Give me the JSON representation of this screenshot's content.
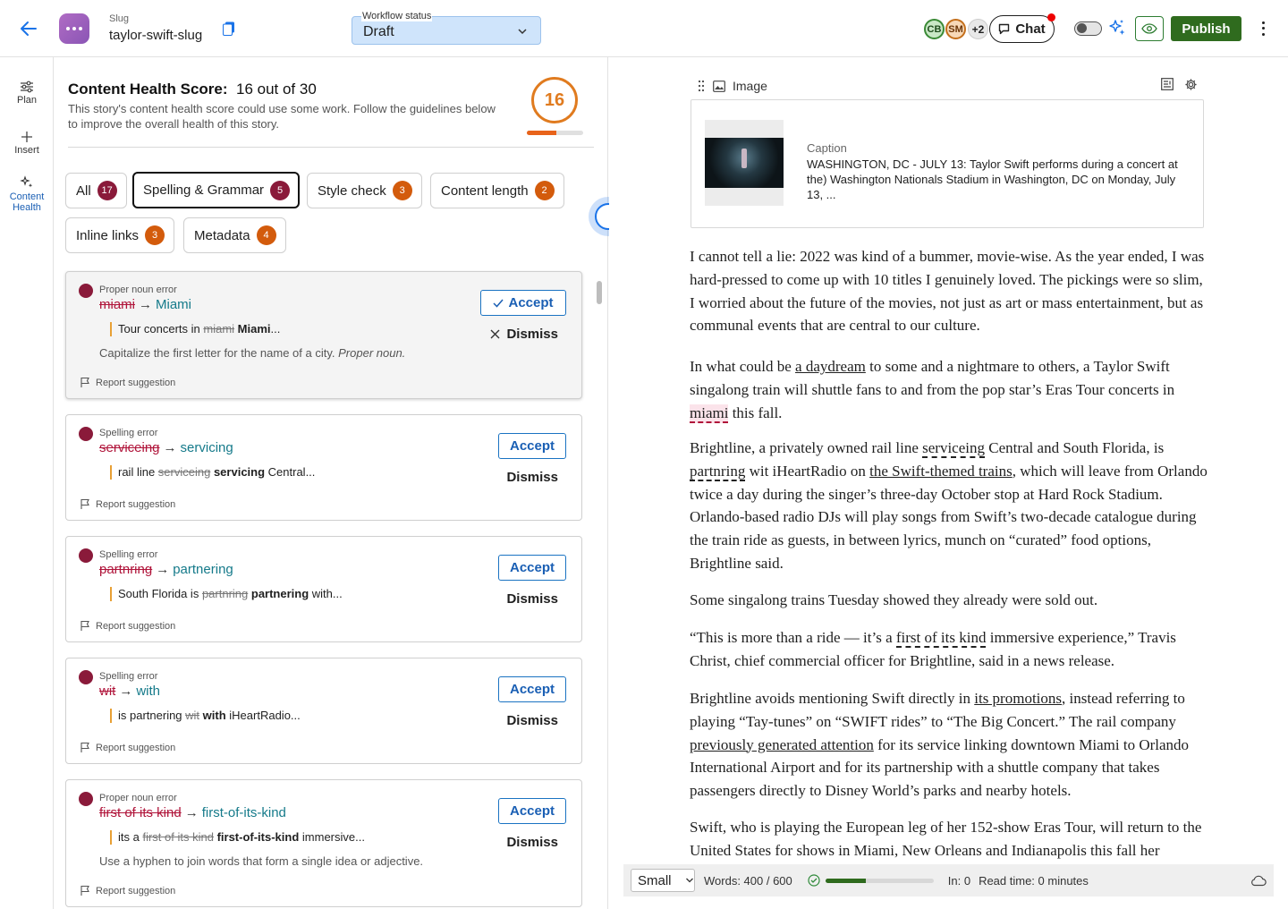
{
  "header": {
    "slug_label": "Slug",
    "slug_value": "taylor-swift-slug",
    "workflow_label": "Workflow status",
    "workflow_value": "Draft",
    "avatars": [
      "CB",
      "SM",
      "+2"
    ],
    "chat_label": "Chat",
    "publish_label": "Publish",
    "accent": "#1a73e8",
    "publish_color": "#2f6b1e"
  },
  "rail": {
    "items": [
      {
        "label": "Plan",
        "icon": "sliders-icon"
      },
      {
        "label": "Insert",
        "icon": "plus-icon"
      },
      {
        "label": "Content Health",
        "icon": "sparkle-icon"
      }
    ]
  },
  "health": {
    "title": "Content Health Score:",
    "score_text": "16 out of 30",
    "description": "This story's content health score could use some work. Follow the guidelines below to improve the overall health of this story.",
    "score": "16",
    "score_fraction": 0.53,
    "score_color": "#e07b1f",
    "filters": [
      {
        "label": "All",
        "count": "17"
      },
      {
        "label": "Spelling & Grammar",
        "count": "5"
      },
      {
        "label": "Style check",
        "count": "3"
      },
      {
        "label": "Content length",
        "count": "2"
      },
      {
        "label": "Inline links",
        "count": "3"
      },
      {
        "label": "Metadata",
        "count": "4"
      }
    ],
    "accept_label": "Accept",
    "dismiss_label": "Dismiss",
    "report_label": "Report suggestion",
    "suggestions": [
      {
        "type": "Proper noun error",
        "wrong": "miami",
        "right": "Miami",
        "ctx_before": "Tour concerts in ",
        "ctx_old": "miami",
        "ctx_new": "Miami",
        "ctx_after": "...",
        "hint": "Capitalize the first letter for the name of a city.",
        "hint_em": "Proper noun."
      },
      {
        "type": "Spelling error",
        "wrong": "serviceing",
        "right": "servicing",
        "ctx_before": "rail line ",
        "ctx_old": "serviceing",
        "ctx_new": "servicing",
        "ctx_after": " Central..."
      },
      {
        "type": "Spelling error",
        "wrong": "partnring",
        "right": "partnering",
        "ctx_before": "South Florida is ",
        "ctx_old": "partnring",
        "ctx_new": "partnering",
        "ctx_after": " with..."
      },
      {
        "type": "Spelling error",
        "wrong": "wit",
        "right": "with",
        "ctx_before": "is partnering ",
        "ctx_old": "wit",
        "ctx_new": "with",
        "ctx_after": " iHeartRadio..."
      },
      {
        "type": "Proper noun error",
        "wrong": "first of its kind",
        "right": "first-of-its-kind",
        "ctx_before": "its a ",
        "ctx_old": "first of its kind",
        "ctx_new": "first-of-its-kind",
        "ctx_after": " immersive...",
        "hint": "Use a hyphen to join words that form a single idea or adjective."
      }
    ]
  },
  "editor": {
    "block_label": "Image",
    "caption_label": "Caption",
    "caption": "WASHINGTON, DC - JULY 13: Taylor Swift performs during a concert at the) Washington Nationals Stadium in Washington, DC on Monday, July 13, ...",
    "p1": "I cannot tell a lie: 2022 was kind of a bummer, movie-wise. As the year ended, I was hard-pressed to come up with 10 titles I genuinely loved. The pickings were so slim, I worried about the future of the movies, not just as art or mass entertainment, but as communal events that are central to our culture.",
    "p2": {
      "a": "In what could be ",
      "link": "a daydream",
      "b": " to some and a nightmare to others, a Taylor Swift singalong train will shuttle fans to and from the pop star’s Eras Tour concerts in ",
      "err": "miami",
      "c": " this fall."
    },
    "p3": {
      "a": "Brightline, a privately owned rail line ",
      "err1": "serviceing",
      "b": " Central and South Florida, is ",
      "err2": "partnring",
      "c": " wit iHeartRadio on ",
      "link": "the Swift-themed trains",
      "d": ", which will leave from Orlando twice a day during the singer’s three-day October stop at Hard Rock Stadium. Orlando-based radio DJs will play songs from Swift’s two-decade catalogue during the train ride as guests, in between lyrics, munch on “curated” food options, Brightline said."
    },
    "p4": "Some singalong trains Tuesday showed they already were sold out.",
    "p5": {
      "a": "“This is more than a ride — it’s a ",
      "err": "first of its kind",
      "b": " immersive experience,” Travis Christ, chief commercial officer for Brightline, said in a news release."
    },
    "p6": {
      "a": "Brightline avoids mentioning Swift directly in ",
      "link1": "its promotions",
      "b": ", instead referring to playing “Tay-tunes” on “SWIFT rides” to “The Big Concert.” The rail company ",
      "link2": "previously generated attention",
      "c": " for its service linking downtown Miami to Orlando International Airport and for its partnership with a shuttle company that takes passengers directly to Disney World’s parks and nearby hotels."
    },
    "p7": "Swift, who is playing the European leg of her 152-show Eras Tour, will return to the United States for shows in Miami, New Orleans and Indianapolis this fall her"
  },
  "statusbar": {
    "size": "Small",
    "words": "Words: 400 / 600",
    "words_fraction": 0.37,
    "inlinks": "In: 0",
    "readtime": "Read time: 0 minutes"
  }
}
